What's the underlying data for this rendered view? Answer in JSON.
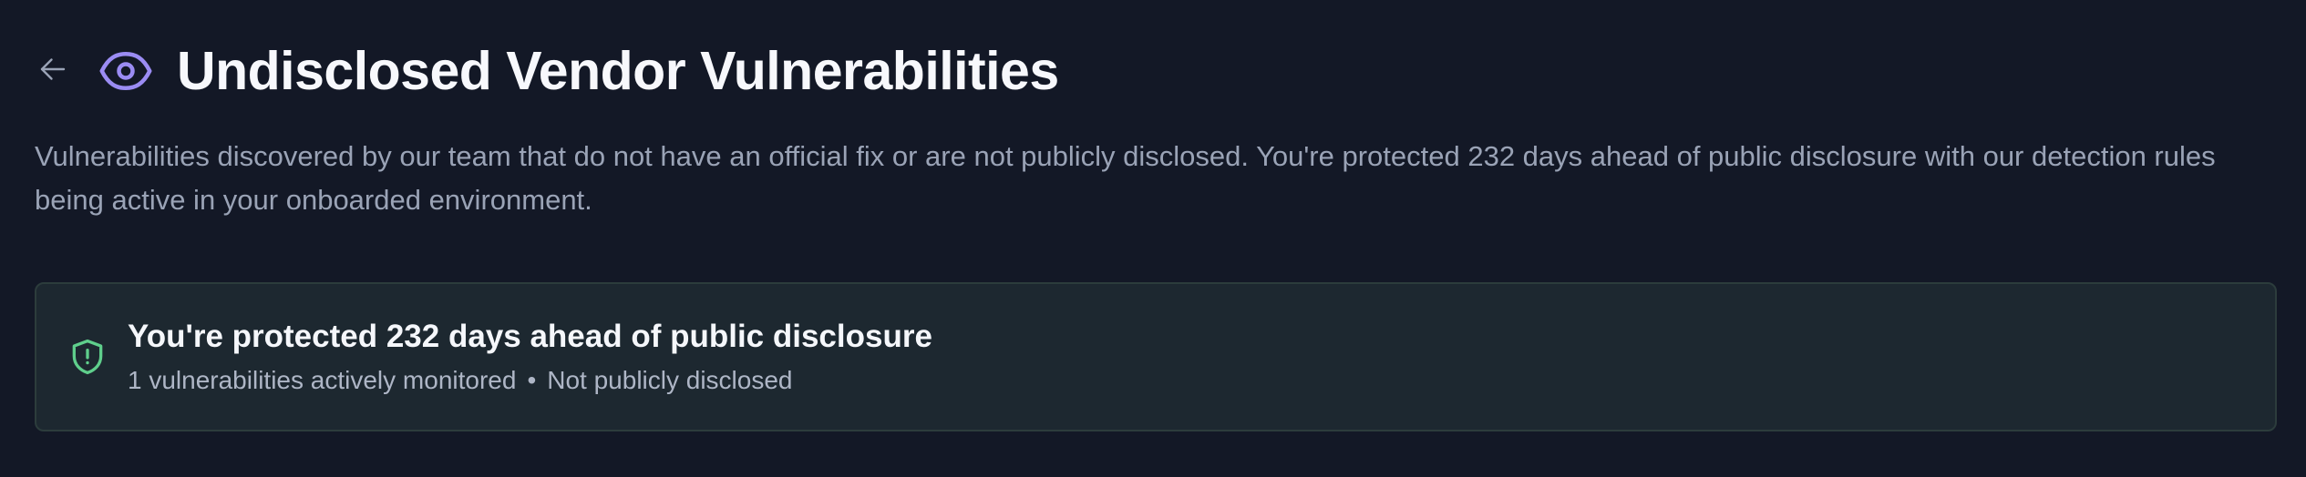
{
  "header": {
    "title": "Undisclosed Vendor Vulnerabilities",
    "back_icon": "arrow-left-icon",
    "title_icon": "eye-icon"
  },
  "description": "Vulnerabilities discovered by our team that do not have an official fix or are not publicly disclosed. You're protected 232 days ahead of public disclosure with our detection rules being active in your onboarded environment.",
  "banner": {
    "icon": "shield-alert-icon",
    "title": "You're protected 232 days ahead of public disclosure",
    "monitored_text": "1 vulnerabilities actively monitored",
    "separator": "•",
    "status_text": "Not publicly disclosed"
  },
  "colors": {
    "background": "#131826",
    "accent_purple": "#9b8cf3",
    "shield_green": "#5fcf8c",
    "banner_background": "#1d2830",
    "banner_border": "#2c3c3c",
    "muted_text": "#9aa3b6"
  }
}
